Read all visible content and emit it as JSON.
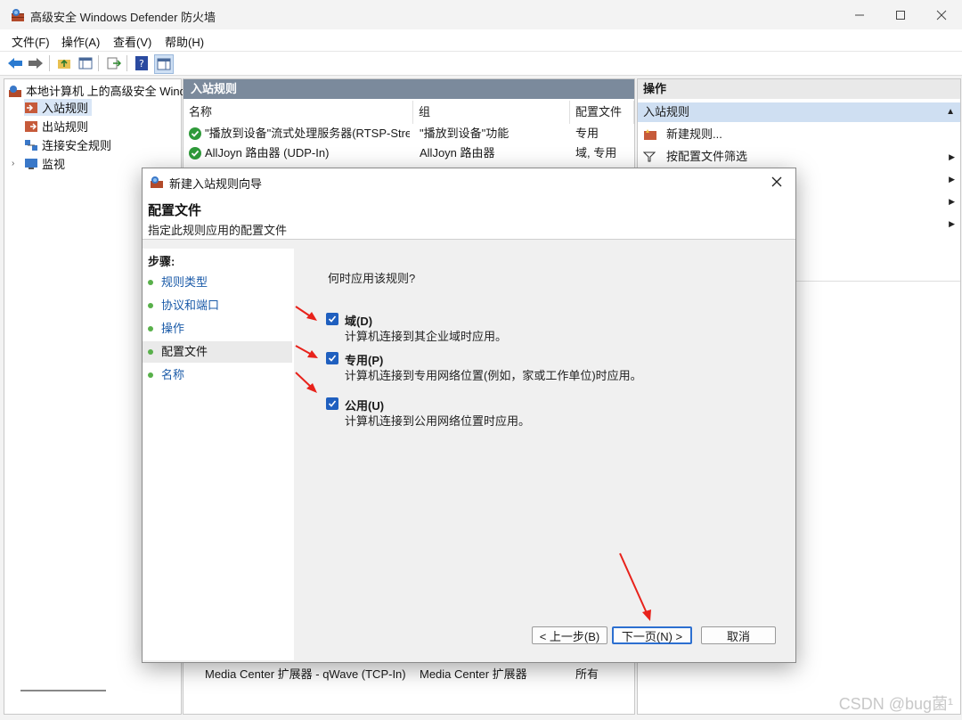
{
  "window": {
    "title": "高级安全 Windows Defender 防火墙"
  },
  "menu": {
    "file": "文件(F)",
    "action": "操作(A)",
    "view": "查看(V)",
    "help": "帮助(H)"
  },
  "tree": {
    "root": "本地计算机 上的高级安全 Windo",
    "inbound": "入站规则",
    "outbound": "出站规则",
    "connection": "连接安全规则",
    "monitor": "监视"
  },
  "center": {
    "header": "入站规则",
    "columns": [
      "名称",
      "组",
      "配置文件"
    ],
    "rows": [
      {
        "name": "\"播放到设备\"流式处理服务器(RTSP-Stre...",
        "group": "\"播放到设备\"功能",
        "profile": "专用"
      },
      {
        "name": "AllJoyn 路由器 (UDP-In)",
        "group": "AllJoyn 路由器",
        "profile": "域, 专用"
      }
    ],
    "bottom_row": {
      "name": "Media Center 扩展器 - qWave (TCP-In)",
      "group": "Media Center 扩展器",
      "profile": "所有"
    }
  },
  "actions": {
    "header": "操作",
    "section": "入站规则",
    "items": [
      "新建规则...",
      "按配置文件筛选"
    ]
  },
  "dialog": {
    "title": "新建入站规则向导",
    "heading": "配置文件",
    "subheading": "指定此规则应用的配置文件",
    "steps_title": "步骤:",
    "steps": [
      "规则类型",
      "协议和端口",
      "操作",
      "配置文件",
      "名称"
    ],
    "current_step": "配置文件",
    "question": "何时应用该规则?",
    "options": [
      {
        "label": "域(D)",
        "desc": "计算机连接到其企业域时应用。",
        "checked": true
      },
      {
        "label": "专用(P)",
        "desc": "计算机连接到专用网络位置(例如，家或工作单位)时应用。",
        "checked": true
      },
      {
        "label": "公用(U)",
        "desc": "计算机连接到公用网络位置时应用。",
        "checked": true
      }
    ],
    "buttons": {
      "back": "< 上一步(B)",
      "next": "下一页(N) >",
      "cancel": "取消"
    }
  },
  "watermark": "CSDN @bug菌¹",
  "colors": {
    "accent": "#1f5fbf",
    "annotation": "#e8221b",
    "pane_header": "#7b8a9c"
  }
}
